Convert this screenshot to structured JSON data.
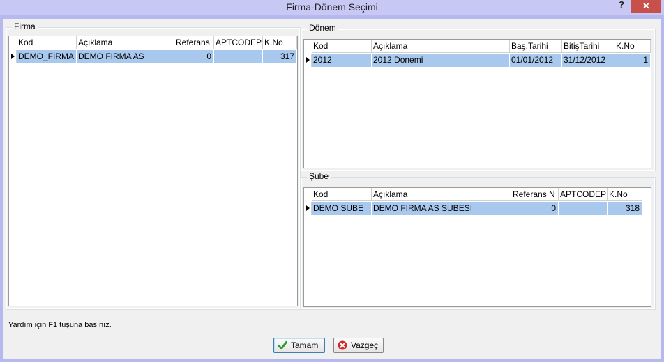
{
  "window": {
    "title": "Firma-Dönem Seçimi",
    "help_glyph": "?",
    "close_glyph": "✕"
  },
  "firma": {
    "label": "Firma",
    "columns": [
      "Kod",
      "Açıklama",
      "Referans",
      "APTCODEP",
      "K.No"
    ],
    "rows": [
      {
        "kod": "DEMO_FIRMA",
        "aciklama": "DEMO FIRMA AS",
        "referans": "0",
        "aptcodep": "",
        "kno": "317"
      }
    ]
  },
  "donem": {
    "label": "Dönem",
    "columns": [
      "Kod",
      "Açıklama",
      "Baş.Tarihi",
      "BitişTarihi",
      "K.No"
    ],
    "rows": [
      {
        "kod": "2012",
        "aciklama": "2012 Donemi",
        "bas": "01/01/2012",
        "bitis": "31/12/2012",
        "kno": "1"
      }
    ]
  },
  "sube": {
    "label": "Şube",
    "columns": [
      "Kod",
      "Açıklama",
      "Referans N",
      "APTCODEP",
      "K.No"
    ],
    "rows": [
      {
        "kod": "DEMO SUBE",
        "aciklama": "DEMO FIRMA AS SUBESI",
        "referans": "0",
        "aptcodep": "",
        "kno": "318"
      }
    ]
  },
  "status": {
    "text": "Yardım için F1 tuşuna basınız."
  },
  "buttons": {
    "ok": {
      "mnemonic": "T",
      "rest": "amam",
      "icon": "checkmark-icon",
      "color": "#2e9a2e"
    },
    "cancel": {
      "mnemonic": "V",
      "rest": "azgeç",
      "icon": "cancel-icon",
      "color": "#d22a2a"
    }
  }
}
